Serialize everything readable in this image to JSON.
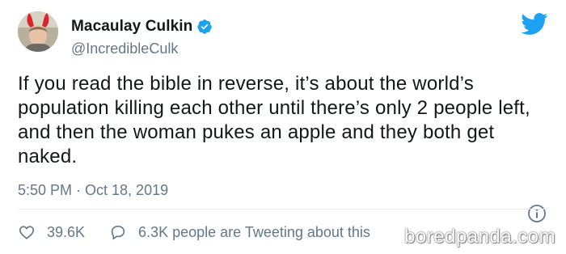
{
  "author": {
    "display_name": "Macaulay Culkin",
    "handle": "@IncredibleCulk",
    "verified": true,
    "avatar_icon": "profile-photo-bunny-ears"
  },
  "tweet": {
    "text": "If you read the bible in reverse, it’s about the world’s population killing each other until there’s only 2 people left, and then the woman pukes an apple and they both get naked.",
    "timestamp": "5:50 PM · Oct 18, 2019"
  },
  "actions": {
    "likes": "39.6K",
    "conversation": "6.3K people are Tweeting about this"
  },
  "watermark": "boredpanda.com",
  "colors": {
    "twitter_blue": "#1da1f2",
    "text": "#14171a",
    "secondary": "#657786",
    "divider": "#e6ecf0"
  }
}
